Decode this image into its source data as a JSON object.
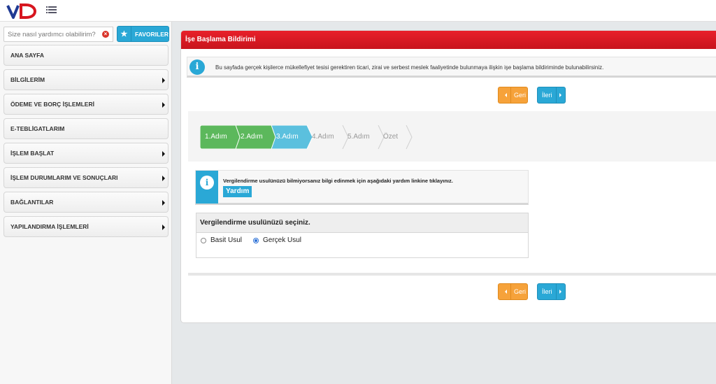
{
  "header": {
    "logo_text": "VD"
  },
  "sidebar": {
    "search": {
      "placeholder": "Size nasıl yardımcı olabilirim?",
      "value": ""
    },
    "favorites_label": "FAVORILER",
    "items": [
      {
        "label": "ANA SAYFA",
        "has_submenu": false
      },
      {
        "label": "BİLGİLERİM",
        "has_submenu": true
      },
      {
        "label": "ÖDEME VE BORÇ İŞLEMLERİ",
        "has_submenu": true
      },
      {
        "label": "E-TEBLİGATLARIM",
        "has_submenu": false
      },
      {
        "label": "İŞLEM BAŞLAT",
        "has_submenu": true
      },
      {
        "label": "İŞLEM DURUMLARIM VE SONUÇLARI",
        "has_submenu": true
      },
      {
        "label": "BAĞLANTILAR",
        "has_submenu": true
      },
      {
        "label": "YAPILANDIRMA İŞLEMLERİ",
        "has_submenu": true
      }
    ]
  },
  "main": {
    "title": "İşe Başlama Bildirimi",
    "info_text": "Bu sayfada gerçek kişilerce mükellefiyet tesisi gerektiren ticari, zirai ve serbest meslek faaliyetinde bulunmaya ilişkin işe başlama bildiriminde bulunabilirsiniz.",
    "nav_top": {
      "back": "Geri",
      "next": "İleri"
    },
    "nav_bottom": {
      "back": "Geri",
      "next": "İleri"
    },
    "steps": [
      {
        "label": "1.Adım",
        "state": "done"
      },
      {
        "label": "2.Adım",
        "state": "done"
      },
      {
        "label": "3.Adım",
        "state": "active"
      },
      {
        "label": "4.Adım",
        "state": "todo"
      },
      {
        "label": "5.Adım",
        "state": "todo"
      },
      {
        "label": "Özet",
        "state": "todo"
      }
    ],
    "help": {
      "text": "Vergilendirme usulünüzü bilmiyorsanız bilgi edinmek için aşağıdaki yardım linkine tıklayınız.",
      "link": "Yardım"
    },
    "method": {
      "heading": "Vergilendirme usulünüzü seçiniz.",
      "options": [
        "Basit Usul",
        "Gerçek Usul"
      ],
      "selected": "Gerçek Usul"
    }
  },
  "colors": {
    "header_red": "#d7161f",
    "accent_blue": "#2aa8d6",
    "step_done": "#5cb85c",
    "step_active": "#5bc0de",
    "back_orange": "#f6a23a"
  }
}
